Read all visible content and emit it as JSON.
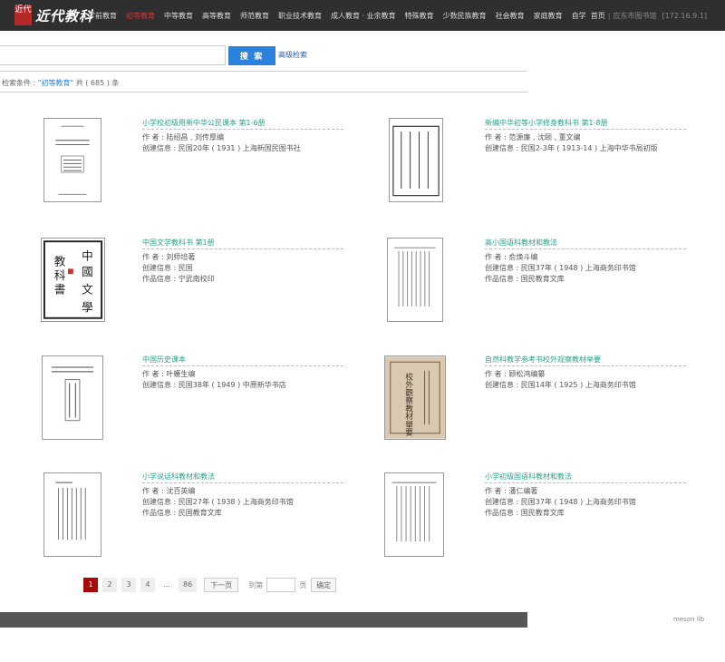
{
  "header": {
    "logo_seal": "近代",
    "logo_text": "近代教科",
    "nav": [
      "学前教育",
      "初等教育",
      "中等教育",
      "高等教育",
      "师范教育",
      "职业技术教育",
      "成人教育 · 业余教育",
      "特殊教育",
      "少数民族教育",
      "社会教育",
      "家庭教育",
      "自学"
    ],
    "active_index": 1,
    "home": "首页",
    "library": "应东市图书馆",
    "ip": "[172.16.9.1]"
  },
  "search": {
    "placeholder": "",
    "button": "搜 索",
    "advanced": "高级检索"
  },
  "condition": {
    "prefix": "检索条件 : ",
    "query": "\"初等教育\"",
    "mid": " 共 ( ",
    "count": "685",
    "suffix": " ) 条"
  },
  "items": [
    {
      "title": "小学校初级用新中华公民课本 第1-6册",
      "lines": [
        "作 者 : 陆绍昌 , 刘传厚编",
        "创建信息 : 民国20年 ( 1931 ) 上海新国民图书社"
      ]
    },
    {
      "title": "新编中华初等小学修身教科书 第1-8册",
      "lines": [
        "作 者 : 范源廉 , 沈颐 , 董文编",
        "创建信息 : 民国2-3年 ( 1913-14 ) 上海中华书局初版"
      ]
    },
    {
      "title": "中国文学教科书 第1册",
      "lines": [
        "作 者 : 刘师培著",
        "创建信息 : 民国",
        "作品信息 : 宁武南校印"
      ]
    },
    {
      "title": "高小国语科教材和教法",
      "lines": [
        "作 者 : 俞焕斗编",
        "创建信息 : 民国37年 ( 1948 ) 上海商务印书馆",
        "作品信息 : 国民教育文库"
      ]
    },
    {
      "title": "中国历史课本",
      "lines": [
        "作 者 : 叶蠖生编",
        "创建信息 : 民国38年 ( 1949 ) 中原新华书店"
      ]
    },
    {
      "title": "自然科教学参考书校外观察教材举要",
      "lines": [
        "作 者 : 顾松鸿编纂",
        "创建信息 : 民国14年 ( 1925 ) 上海商务印书馆"
      ]
    },
    {
      "title": "小学说话科教材和教法",
      "lines": [
        "作 者 : 沈百英编",
        "创建信息 : 民国27年 ( 1938 ) 上海商务印书馆",
        "作品信息 : 民国教育文库"
      ]
    },
    {
      "title": "小学初级国语科教材和教法",
      "lines": [
        "作 者 : 潘仁编著",
        "创建信息 : 民国37年 ( 1948 ) 上海商务印书馆",
        "作品信息 : 国民教育文库"
      ]
    }
  ],
  "covers": {
    "c3": [
      "中",
      "國",
      "文",
      "學",
      "教",
      "科",
      "書"
    ],
    "c6": "校外觀察教材舉要"
  },
  "pagination": {
    "pages": [
      "1",
      "2",
      "3",
      "4"
    ],
    "ellipsis": "...",
    "last": "86",
    "next": "下一页",
    "goto_label": "到第",
    "goto_unit": "页",
    "confirm": "确定"
  },
  "footer": {
    "credit": "meson lib"
  }
}
